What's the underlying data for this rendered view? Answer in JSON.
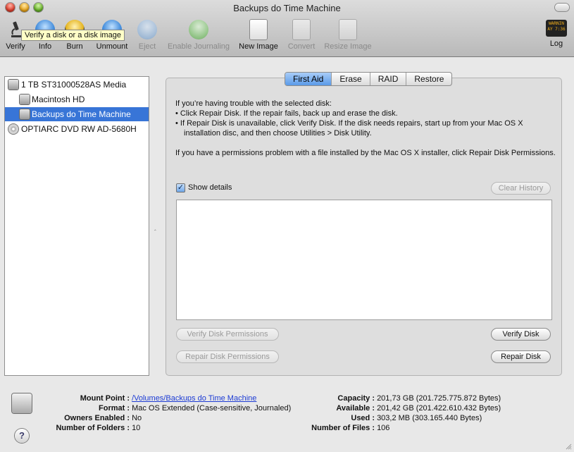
{
  "window": {
    "title": "Backups do Time Machine"
  },
  "toolbar": {
    "items": [
      {
        "label": "Verify",
        "icon": "microscope-icon"
      },
      {
        "label": "Info",
        "icon": "info-icon"
      },
      {
        "label": "Burn",
        "icon": "burn-icon"
      },
      {
        "label": "Unmount",
        "icon": "unmount-icon"
      },
      {
        "label": "Eject",
        "icon": "eject-icon"
      },
      {
        "label": "Enable Journaling",
        "icon": "journaling-icon"
      },
      {
        "label": "New Image",
        "icon": "new-image-icon"
      },
      {
        "label": "Convert",
        "icon": "convert-icon"
      },
      {
        "label": "Resize Image",
        "icon": "resize-image-icon"
      },
      {
        "label": "Log",
        "icon": "log-icon"
      }
    ],
    "log_icon_text": "WARNIN\nAY 7:36"
  },
  "tooltip": "Verify a disk or a disk image",
  "sidebar": {
    "items": [
      {
        "label": "1 TB ST31000528AS Media"
      },
      {
        "label": "Macintosh HD"
      },
      {
        "label": "Backups do Time Machine"
      },
      {
        "label": "OPTIARC DVD RW AD-5680H"
      }
    ]
  },
  "tabs": [
    "First Aid",
    "Erase",
    "RAID",
    "Restore"
  ],
  "first_aid": {
    "intro": "If you’re having trouble with the selected disk:",
    "bullet1": "• Click Repair Disk. If the repair fails, back up and erase the disk.",
    "bullet2": "• If Repair Disk is unavailable, click Verify Disk. If the disk needs repairs, start up from your Mac OS X installation disc, and then choose Utilities > Disk Utility.",
    "permissions": "If you have a permissions problem with a file installed by the Mac OS X installer, click Repair Disk Permissions.",
    "show_details": "Show details",
    "clear_history": "Clear History",
    "verify_permissions": "Verify Disk Permissions",
    "repair_permissions": "Repair Disk Permissions",
    "verify_disk": "Verify Disk",
    "repair_disk": "Repair Disk"
  },
  "info": {
    "mount_point_label": "Mount Point :",
    "mount_point": "/Volumes/Backups do Time Machine",
    "format_label": "Format :",
    "format": "Mac OS Extended (Case-sensitive, Journaled)",
    "owners_label": "Owners Enabled :",
    "owners": "No",
    "folders_label": "Number of Folders :",
    "folders": "10",
    "capacity_label": "Capacity :",
    "capacity": "201,73 GB (201.725.775.872 Bytes)",
    "available_label": "Available :",
    "available": "201,42 GB (201.422.610.432 Bytes)",
    "used_label": "Used :",
    "used": "303,2 MB (303.165.440 Bytes)",
    "files_label": "Number of Files :",
    "files": "106"
  },
  "help_glyph": "?",
  "checkmark": "✓",
  "splitter_glyph": "‸"
}
